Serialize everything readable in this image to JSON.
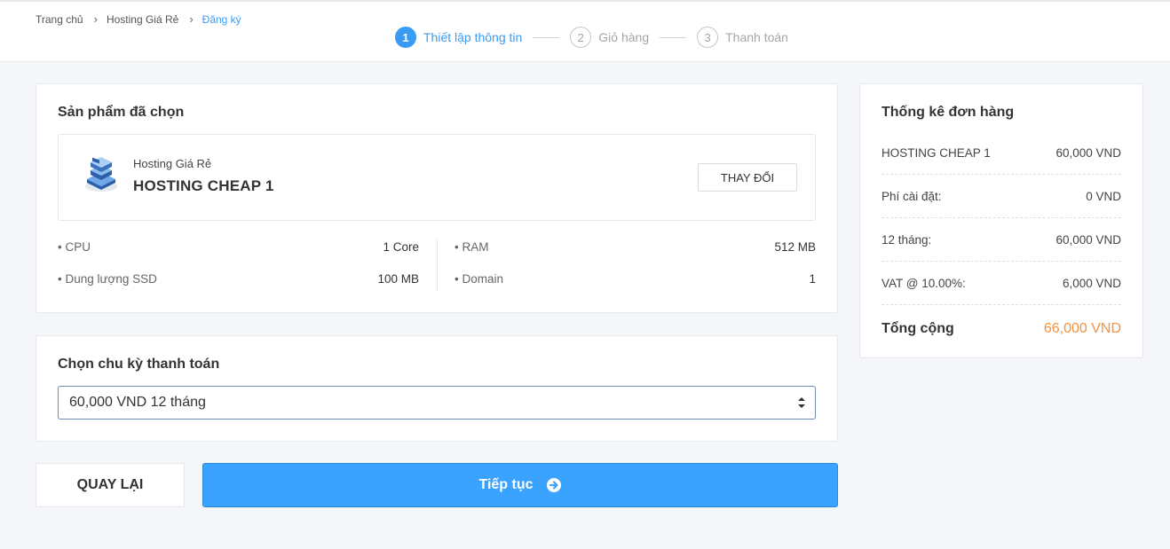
{
  "breadcrumb": {
    "items": [
      "Trang chủ",
      "Hosting Giá Rẻ",
      "Đăng ký"
    ]
  },
  "steps": [
    {
      "num": "1",
      "label": "Thiết lập thông tin",
      "active": true
    },
    {
      "num": "2",
      "label": "Giỏ hàng",
      "active": false
    },
    {
      "num": "3",
      "label": "Thanh toán",
      "active": false
    }
  ],
  "product": {
    "section_title": "Sản phẩm đã chọn",
    "category": "Hosting Giá Rẻ",
    "name": "HOSTING CHEAP 1",
    "change_label": "THAY ĐỔI",
    "icon": "server-stack-icon",
    "specs_left": [
      {
        "label": "• CPU",
        "value": "1 Core"
      },
      {
        "label": "• Dung lượng SSD",
        "value": "100 MB"
      }
    ],
    "specs_right": [
      {
        "label": "• RAM",
        "value": "512 MB"
      },
      {
        "label": "• Domain",
        "value": "1"
      }
    ]
  },
  "billing": {
    "section_title": "Chọn chu kỳ thanh toán",
    "selected": "60,000 VND 12 tháng"
  },
  "actions": {
    "back_label": "QUAY LẠI",
    "next_label": "Tiếp tục"
  },
  "summary": {
    "title": "Thống kê đơn hàng",
    "rows": [
      {
        "label": "HOSTING CHEAP 1",
        "value": "60,000 VND"
      },
      {
        "label": "Phí cài đặt:",
        "value": "0 VND"
      },
      {
        "label": "12 tháng:",
        "value": "60,000 VND"
      },
      {
        "label": "VAT @ 10.00%:",
        "value": "6,000 VND"
      }
    ],
    "total_label": "Tổng cộng",
    "total_value": "66,000 VND"
  },
  "colors": {
    "accent": "#3aa3ff",
    "total": "#f5923e",
    "background": "#f4f6f9"
  }
}
